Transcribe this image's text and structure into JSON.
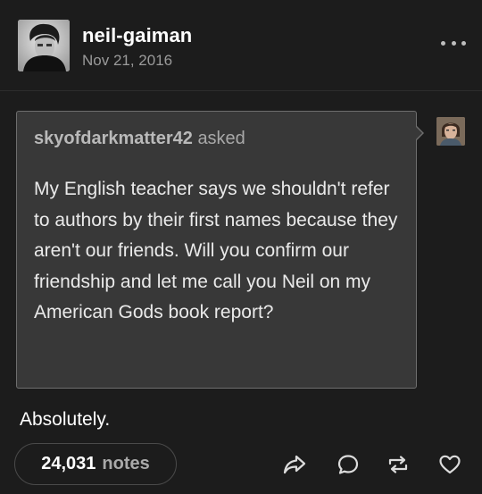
{
  "post": {
    "blog_name": "neil-gaiman",
    "date": "Nov 21, 2016"
  },
  "ask": {
    "asker": "skyofdarkmatter42",
    "asked_label": "asked",
    "question": "My English teacher says we shouldn't refer to authors by their first names because they aren't our friends. Will you confirm our friendship and let me call you Neil on my American Gods book report?"
  },
  "answer": {
    "text": "Absolutely."
  },
  "footer": {
    "notes_count": "24,031",
    "notes_label": "notes",
    "actions": [
      "share-icon",
      "reply-icon",
      "reblog-icon",
      "like-icon"
    ]
  },
  "colors": {
    "background": "#1c1c1c",
    "ask_background": "#383838",
    "ask_border": "#6e6e6e",
    "muted_text": "#9a9a9a"
  }
}
